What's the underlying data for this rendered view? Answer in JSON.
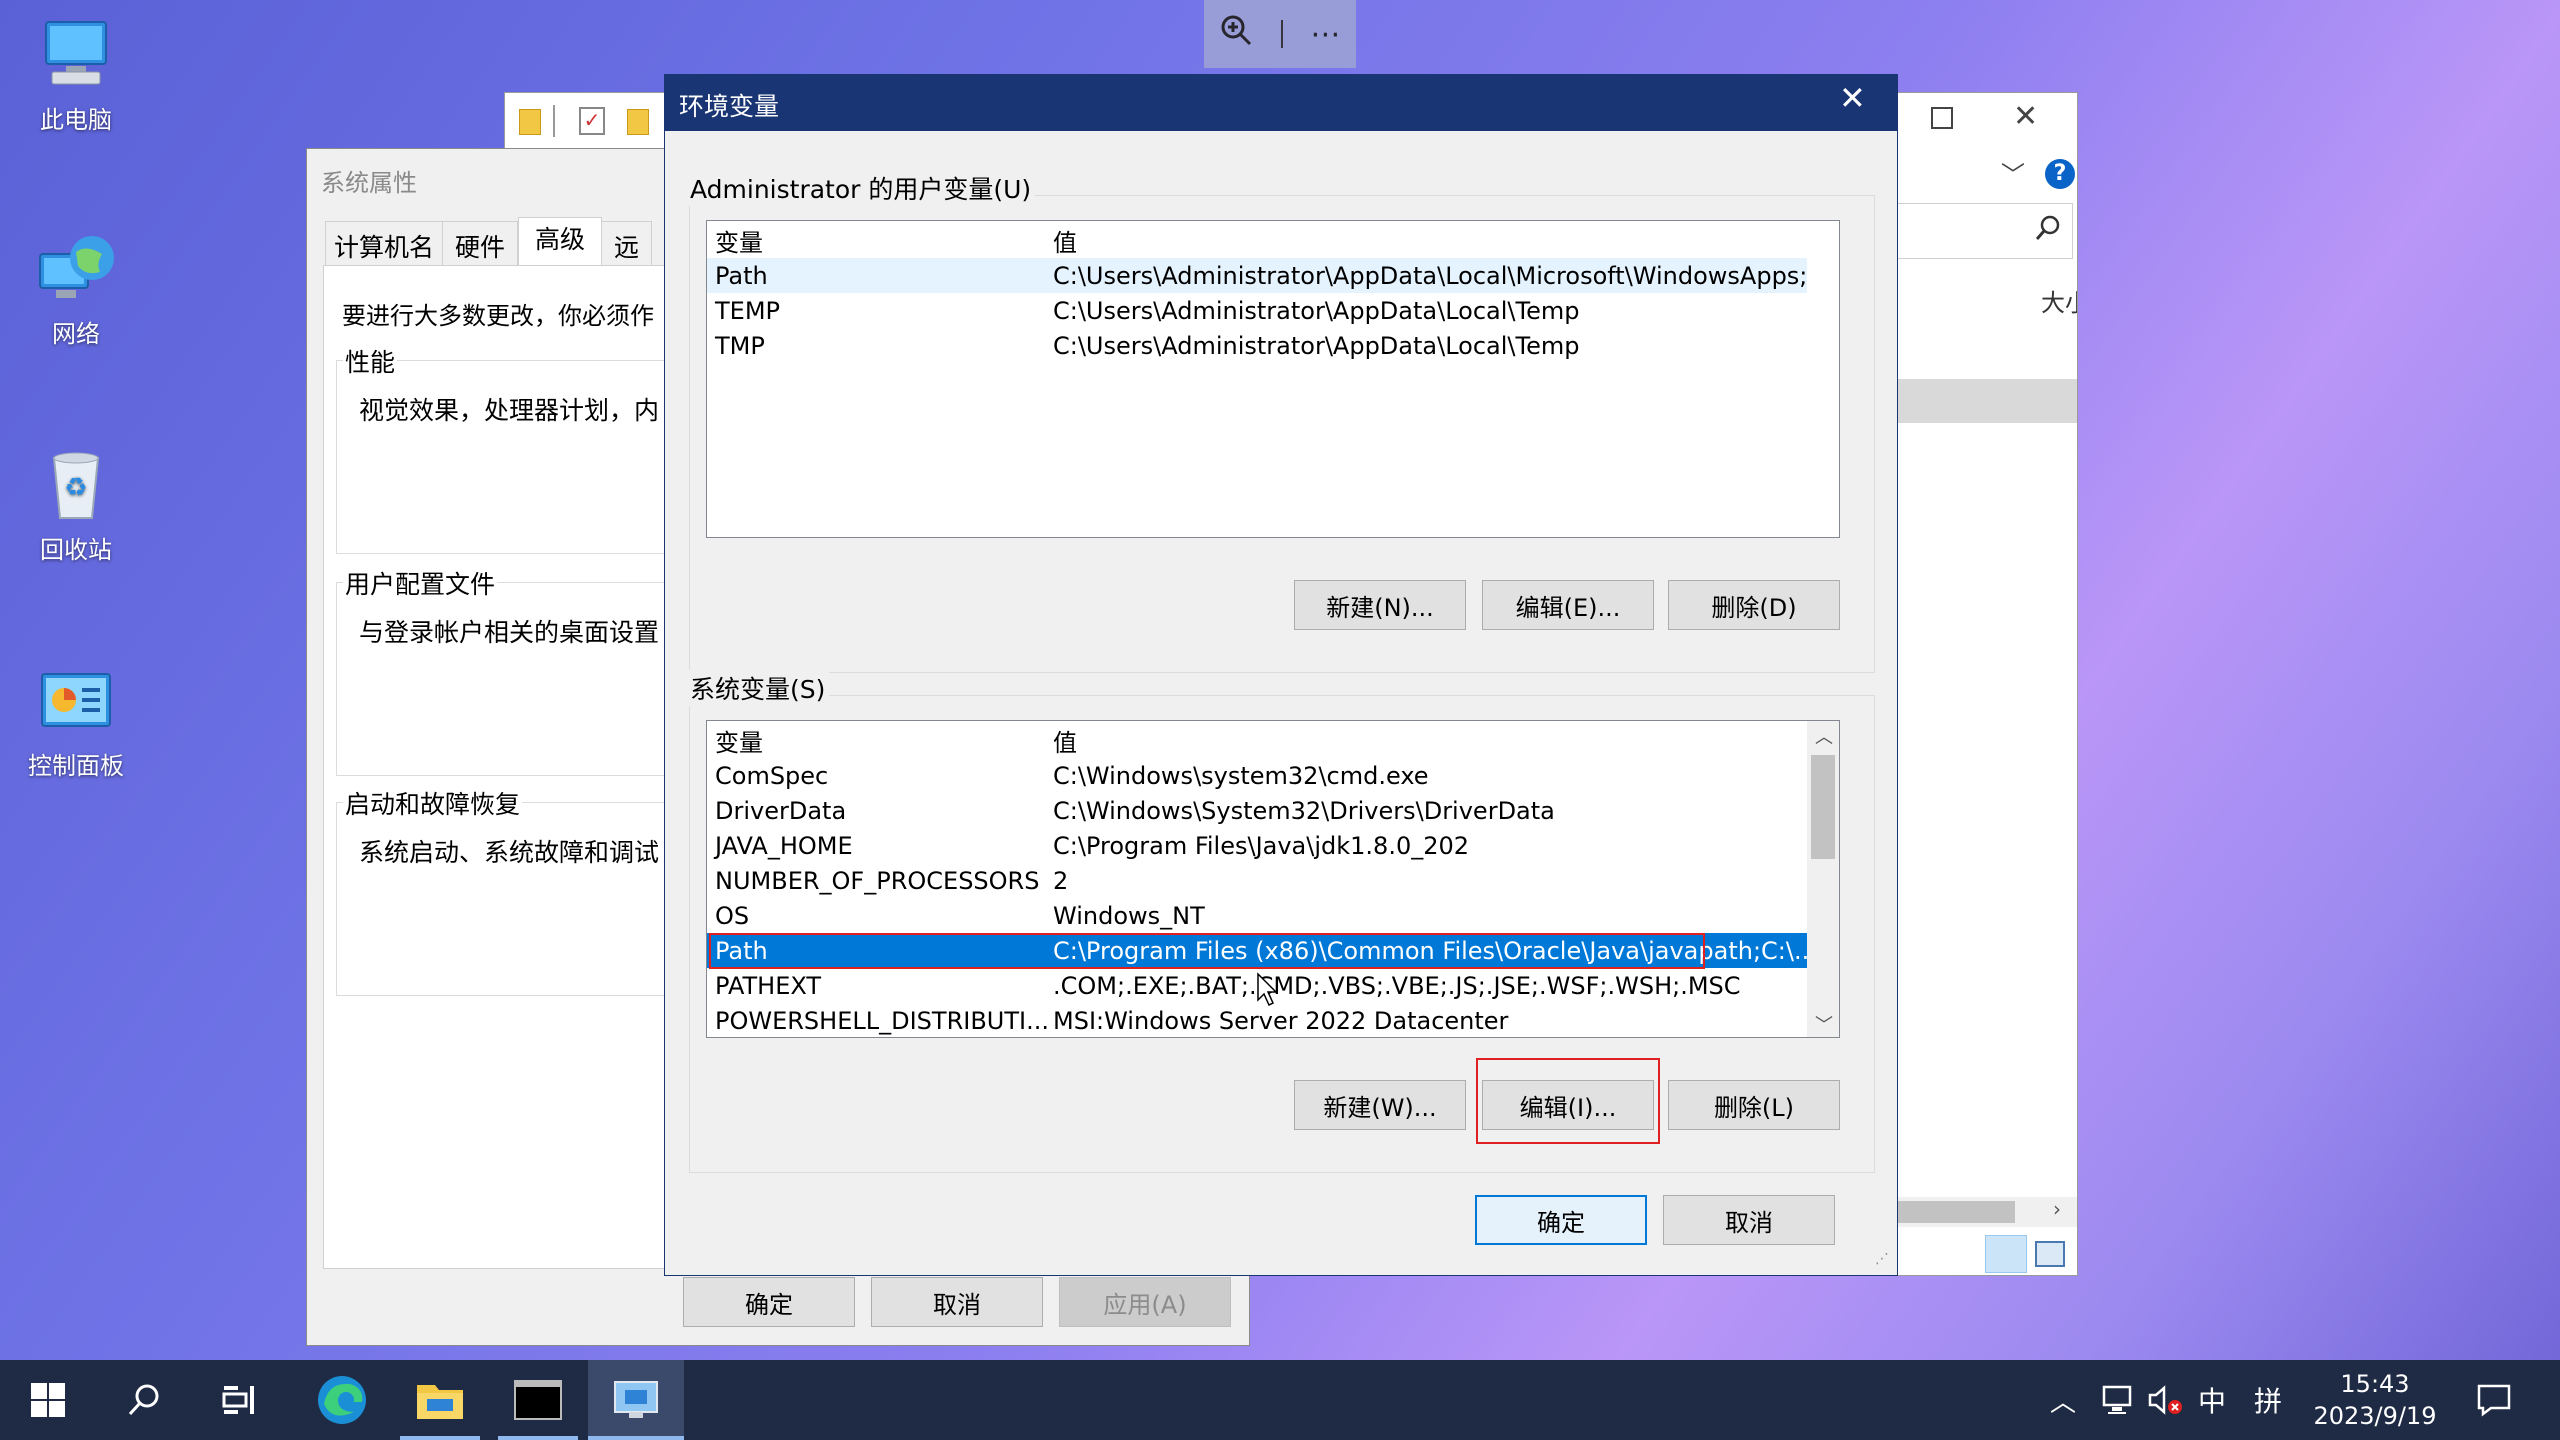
{
  "desktop": {
    "icons": [
      {
        "label": "此电脑",
        "icon": "computer-icon"
      },
      {
        "label": "网络",
        "icon": "network-icon"
      },
      {
        "label": "回收站",
        "icon": "recycle-bin-icon"
      },
      {
        "label": "控制面板",
        "icon": "control-panel-icon"
      }
    ]
  },
  "explorer": {
    "partial_col": "大小"
  },
  "sysprops": {
    "title": "系统属性",
    "tabs": [
      "计算机名",
      "硬件",
      "高级",
      "远"
    ],
    "intro": "要进行大多数更改，你必须作",
    "perf_title": "性能",
    "perf_text": "视觉效果，处理器计划，内",
    "profile_title": "用户配置文件",
    "profile_text": "与登录帐户相关的桌面设置",
    "startup_title": "启动和故障恢复",
    "startup_text": "系统启动、系统故障和调试",
    "ok": "确定",
    "cancel": "取消",
    "apply": "应用(A)"
  },
  "envvars": {
    "title": "环境变量",
    "user_group": "Administrator 的用户变量(U)",
    "col_var": "变量",
    "col_val": "值",
    "user_rows": [
      {
        "name": "Path",
        "value": "C:\\Users\\Administrator\\AppData\\Local\\Microsoft\\WindowsApps;"
      },
      {
        "name": "TEMP",
        "value": "C:\\Users\\Administrator\\AppData\\Local\\Temp"
      },
      {
        "name": "TMP",
        "value": "C:\\Users\\Administrator\\AppData\\Local\\Temp"
      }
    ],
    "user_new": "新建(N)...",
    "user_edit": "编辑(E)...",
    "user_delete": "删除(D)",
    "sys_group": "系统变量(S)",
    "sys_rows": [
      {
        "name": "ComSpec",
        "value": "C:\\Windows\\system32\\cmd.exe"
      },
      {
        "name": "DriverData",
        "value": "C:\\Windows\\System32\\Drivers\\DriverData"
      },
      {
        "name": "JAVA_HOME",
        "value": "C:\\Program Files\\Java\\jdk1.8.0_202"
      },
      {
        "name": "NUMBER_OF_PROCESSORS",
        "value": "2"
      },
      {
        "name": "OS",
        "value": "Windows_NT"
      },
      {
        "name": "Path",
        "value": "C:\\Program Files (x86)\\Common Files\\Oracle\\Java\\javapath;C:\\..."
      },
      {
        "name": "PATHEXT",
        "value": ".COM;.EXE;.BAT;.CMD;.VBS;.VBE;.JS;.JSE;.WSF;.WSH;.MSC"
      },
      {
        "name": "POWERSHELL_DISTRIBUTI...",
        "value": "MSI:Windows Server 2022 Datacenter"
      }
    ],
    "sys_new": "新建(W)...",
    "sys_edit": "编辑(I)...",
    "sys_delete": "删除(L)",
    "ok": "确定",
    "cancel": "取消"
  },
  "taskbar": {
    "time": "15:43",
    "date": "2023/9/19",
    "ime_lang": "中",
    "ime_mode": "拼"
  },
  "colors": {
    "accent": "#0078d7",
    "title_bar": "#1a3574",
    "highlight_border": "#e02020"
  }
}
